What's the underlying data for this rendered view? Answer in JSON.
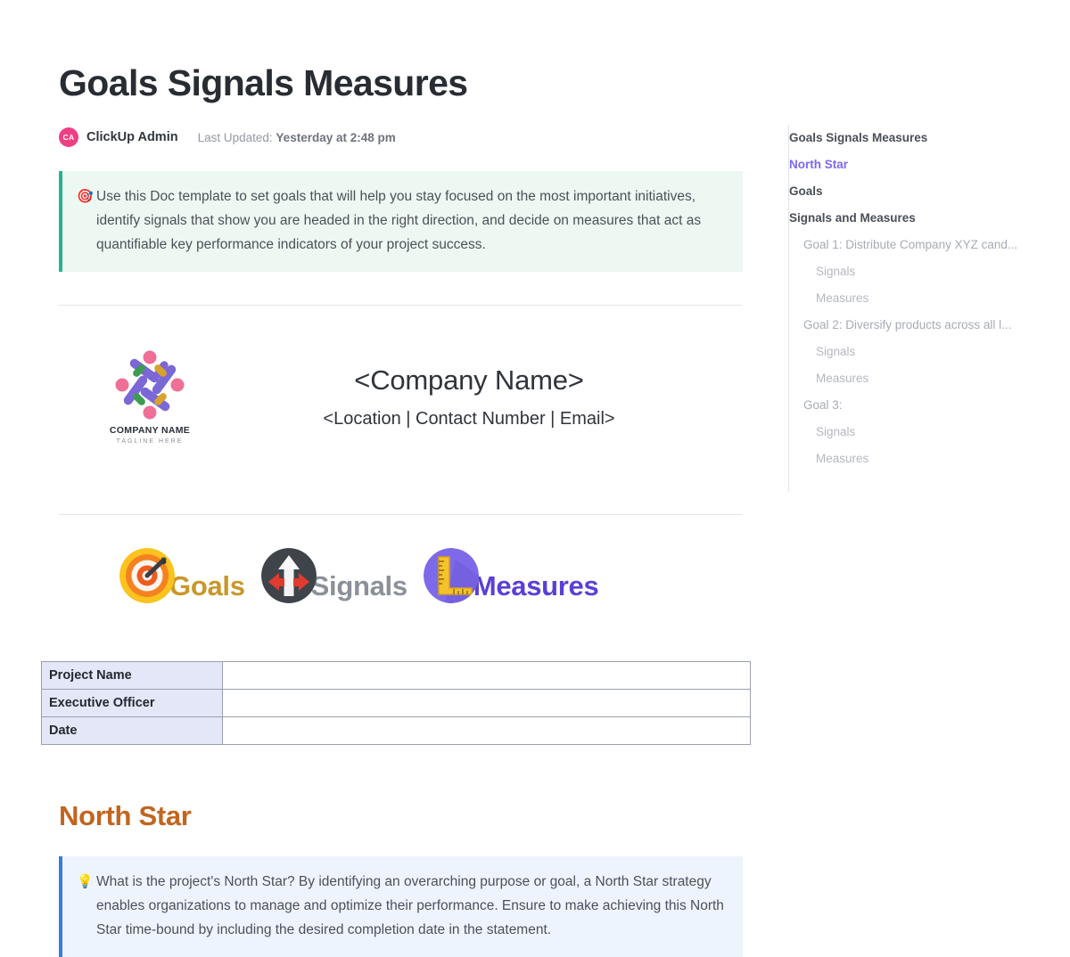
{
  "document": {
    "title": "Goals Signals Measures",
    "byline": {
      "avatar_initials": "CA",
      "author": "ClickUp Admin",
      "updated_prefix": "Last Updated:",
      "updated_value": "Yesterday at 2:48 pm"
    },
    "intro_callout": {
      "icon": "dart-target-icon",
      "icon_glyph": "🎯",
      "text": "Use this Doc template to set goals that will help you stay focused on the most important initiatives, identify signals that show you are headed in the right direction, and decide on measures that act as quantifiable key performance indicators of your project success.",
      "accent_color": "#27b392",
      "background_color": "#edf8f2"
    },
    "company": {
      "logo_name": "COMPANY NAME",
      "logo_tagline": "TAGLINE HERE",
      "name": "<Company Name>",
      "meta": "<Location | Contact Number | Email>"
    },
    "gsm": [
      {
        "icon": "target-icon",
        "label": "Goals",
        "color": "#c9972a"
      },
      {
        "icon": "arrows-direction-icon",
        "label": "Signals",
        "color": "#8b9099"
      },
      {
        "icon": "ruler-icon",
        "label": "Measures",
        "color": "#5b3fd4"
      }
    ],
    "info_table": {
      "rows": [
        {
          "label": "Project Name",
          "value": ""
        },
        {
          "label": "Executive Officer",
          "value": ""
        },
        {
          "label": "Date",
          "value": ""
        }
      ]
    },
    "north_star": {
      "heading": "North Star",
      "heading_color": "#c1651f",
      "callout": {
        "icon": "lightbulb-icon",
        "icon_glyph": "💡",
        "text": "What is the project's North Star? By identifying an overarching purpose or goal, a North Star strategy enables organizations to manage and optimize their performance. Ensure to make achieving this North Star time-bound by including the desired completion date in the statement.",
        "accent_color": "#3b7cdb",
        "background_color": "#eef4fd"
      }
    }
  },
  "toc": {
    "items": [
      {
        "label": "Goals Signals Measures",
        "level": 1,
        "active": false
      },
      {
        "label": "North Star",
        "level": 1,
        "active": true
      },
      {
        "label": "Goals",
        "level": 1,
        "active": false
      },
      {
        "label": "Signals and Measures",
        "level": 1,
        "active": false
      },
      {
        "label": "Goal 1: Distribute Company XYZ cand...",
        "level": 2,
        "active": false
      },
      {
        "label": "Signals",
        "level": 3,
        "active": false
      },
      {
        "label": "Measures",
        "level": 3,
        "active": false
      },
      {
        "label": "Goal 2: Diversify products across all l...",
        "level": 2,
        "active": false
      },
      {
        "label": "Signals",
        "level": 3,
        "active": false
      },
      {
        "label": "Measures",
        "level": 3,
        "active": false
      },
      {
        "label": "Goal 3:",
        "level": 2,
        "active": false
      },
      {
        "label": "Signals",
        "level": 3,
        "active": false
      },
      {
        "label": "Measures",
        "level": 3,
        "active": false
      }
    ]
  }
}
